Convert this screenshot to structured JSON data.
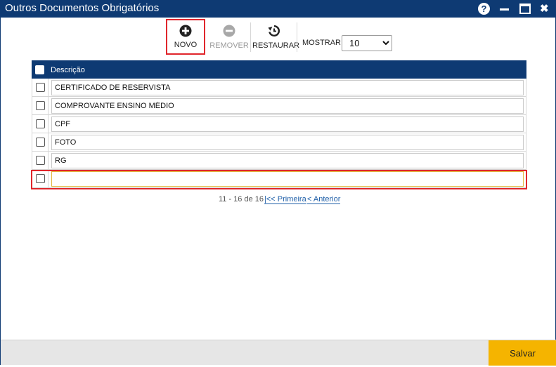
{
  "window": {
    "title": "Outros Documentos Obrigatórios",
    "help_glyph": "?",
    "close_glyph": "✖"
  },
  "toolbar": {
    "novo_label": "NOVO",
    "remover_label": "REMOVER",
    "restaurar_label": "RESTAURAR",
    "mostrar_label": "MOSTRAR:",
    "mostrar_value": "10",
    "mostrar_options": [
      "10"
    ]
  },
  "table": {
    "header": "Descrição",
    "rows": [
      {
        "value": "CERTIFICADO DE RESERVISTA"
      },
      {
        "value": "COMPROVANTE ENSINO MÉDIO"
      },
      {
        "value": "CPF"
      },
      {
        "value": "FOTO"
      },
      {
        "value": "RG"
      },
      {
        "value": ""
      }
    ]
  },
  "pager": {
    "range": "11 - 16 de 16",
    "first": "|<< Primeira",
    "prev": "< Anterior"
  },
  "footer": {
    "save_label": "Salvar"
  },
  "colors": {
    "titlebar": "#0e3a73",
    "save": "#f5b400",
    "highlight": "#e0262c"
  },
  "icons": {
    "novo": "plus-circle-icon",
    "remover": "minus-circle-icon",
    "restaurar": "restore-history-icon"
  }
}
